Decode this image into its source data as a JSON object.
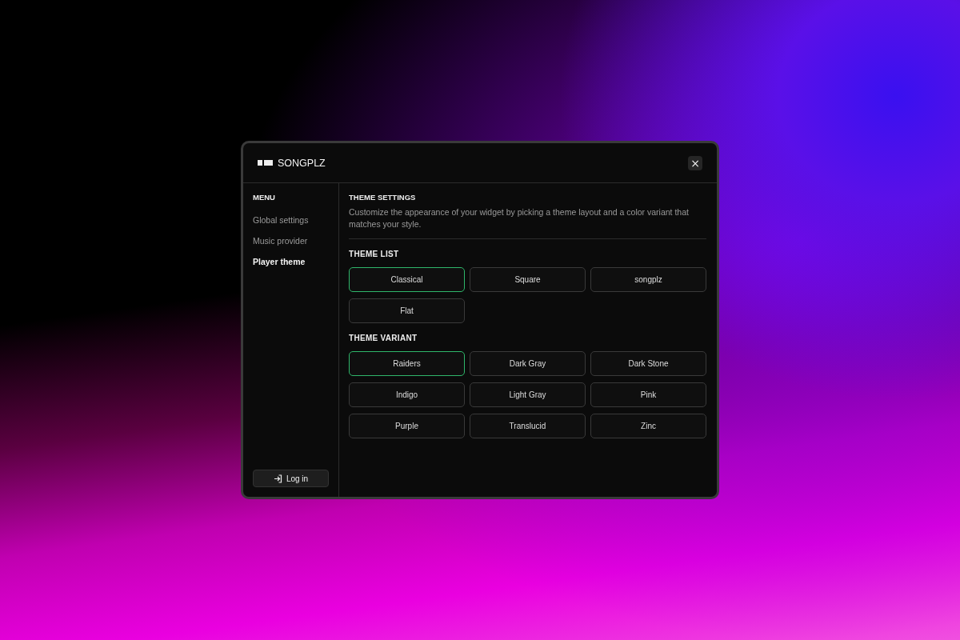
{
  "window": {
    "title": "SONGPLZ",
    "close": "×"
  },
  "sidebar": {
    "heading": "MENU",
    "items": [
      {
        "label": "Global settings",
        "selected": false
      },
      {
        "label": "Music provider",
        "selected": false
      },
      {
        "label": "Player theme",
        "selected": true
      }
    ],
    "login": "Log in"
  },
  "settings": {
    "title": "THEME SETTINGS",
    "description": "Customize the appearance of your widget by picking a theme layout and a color variant that matches your style."
  },
  "theme_list": {
    "title": "THEME LIST",
    "options": [
      {
        "label": "Classical",
        "selected": true
      },
      {
        "label": "Square",
        "selected": false
      },
      {
        "label": "songplz",
        "selected": false
      },
      {
        "label": "Flat",
        "selected": false
      }
    ]
  },
  "theme_variant": {
    "title": "THEME VARIANT",
    "options": [
      {
        "label": "Raiders",
        "selected": true
      },
      {
        "label": "Dark Gray",
        "selected": false
      },
      {
        "label": "Dark Stone",
        "selected": false
      },
      {
        "label": "Indigo",
        "selected": false
      },
      {
        "label": "Light Gray",
        "selected": false
      },
      {
        "label": "Pink",
        "selected": false
      },
      {
        "label": "Purple",
        "selected": false
      },
      {
        "label": "Translucid",
        "selected": false
      },
      {
        "label": "Zinc",
        "selected": false
      }
    ]
  }
}
